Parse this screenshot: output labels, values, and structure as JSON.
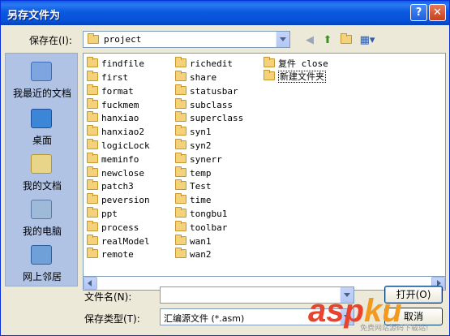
{
  "window": {
    "title": "另存文件为"
  },
  "titlebar": {
    "help_label": "?",
    "close_label": "✕"
  },
  "location": {
    "label": "保存在(I):",
    "value": "project"
  },
  "places": [
    {
      "label": "我最近的文档",
      "icon": "recent-documents-icon"
    },
    {
      "label": "桌面",
      "icon": "desktop-icon"
    },
    {
      "label": "我的文档",
      "icon": "my-documents-icon"
    },
    {
      "label": "我的电脑",
      "icon": "my-computer-icon"
    },
    {
      "label": "网上邻居",
      "icon": "network-places-icon"
    }
  ],
  "files": {
    "col1": [
      "findfile",
      "first",
      "format",
      "fuckmem",
      "hanxiao",
      "hanxiao2",
      "logicLock",
      "meminfo",
      "newclose",
      "patch3",
      "peversion",
      "ppt",
      "process",
      "realModel",
      "remote"
    ],
    "col2": [
      "richedit",
      "share",
      "statusbar",
      "subclass",
      "superclass",
      "syn1",
      "syn2",
      "synerr",
      "temp",
      "Test",
      "time",
      "tongbu1",
      "toolbar",
      "wan1",
      "wan2"
    ],
    "col3": [
      "复件 close",
      "新建文件夹"
    ]
  },
  "filename": {
    "label": "文件名(N):",
    "value": ""
  },
  "filetype": {
    "label": "保存类型(T):",
    "value": "汇编源文件 (*.asm)"
  },
  "buttons": {
    "open": "打开(O)",
    "cancel": "取消"
  },
  "watermark": {
    "brand_a": "asp",
    "brand_b": "ku",
    "sub": "免费网站源码下载站!"
  },
  "colors": {
    "titlebar": "#0a5de4",
    "dialog_bg": "#ece9d8",
    "places_bg": "#b0c3e5",
    "folder": "#f3d27a"
  }
}
